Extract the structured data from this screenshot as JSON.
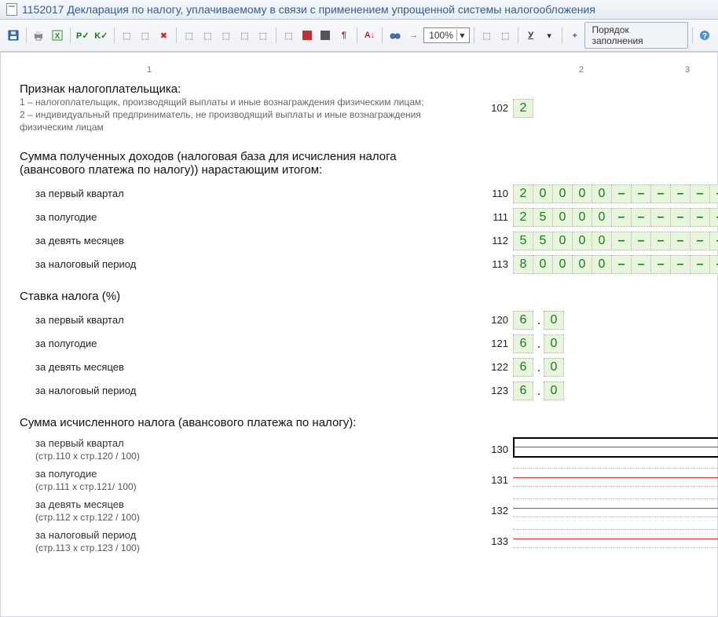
{
  "title": "1152017 Декларация по налогу, уплачиваемому в связи с применением упрощенной системы налогообложения",
  "toolbar": {
    "zoom": "100%",
    "order_button": "Порядок заполнения"
  },
  "columns": {
    "c1": "1",
    "c2": "2",
    "c3": "3"
  },
  "taxpayer_sign": {
    "title": "Признак налогоплательщика:",
    "note1": "1 – налогоплательщик, производящий выплаты и иные вознаграждения физическим лицам;",
    "note2": "2 – индивидуальный предприниматель, не производящий выплаты и иные вознаграждения физическим лицам",
    "code": "102",
    "value": "2"
  },
  "income": {
    "title": "Сумма полученных доходов (налоговая база для исчисления налога (авансового платежа по налогу)) нарастающим итогом:",
    "rows": [
      {
        "label": "за первый квартал",
        "code": "110",
        "digits": [
          "2",
          "0",
          "0",
          "0",
          "0",
          "–",
          "–",
          "–",
          "–",
          "–",
          "–"
        ]
      },
      {
        "label": "за полугодие",
        "code": "111",
        "digits": [
          "2",
          "5",
          "0",
          "0",
          "0",
          "–",
          "–",
          "–",
          "–",
          "–",
          "–"
        ]
      },
      {
        "label": "за девять месяцев",
        "code": "112",
        "digits": [
          "5",
          "5",
          "0",
          "0",
          "0",
          "–",
          "–",
          "–",
          "–",
          "–",
          "–"
        ]
      },
      {
        "label": "за налоговый период",
        "code": "113",
        "digits": [
          "8",
          "0",
          "0",
          "0",
          "0",
          "–",
          "–",
          "–",
          "–",
          "–",
          "–"
        ]
      }
    ]
  },
  "rate": {
    "title": "Ставка налога (%)",
    "rows": [
      {
        "label": "за первый квартал",
        "code": "120",
        "int": "6",
        "dec": "0"
      },
      {
        "label": "за полугодие",
        "code": "121",
        "int": "6",
        "dec": "0"
      },
      {
        "label": "за девять месяцев",
        "code": "122",
        "int": "6",
        "dec": "0"
      },
      {
        "label": "за налоговый период",
        "code": "123",
        "int": "6",
        "dec": "0"
      }
    ]
  },
  "calc": {
    "title": "Сумма исчисленного налога (авансового платежа по налогу):",
    "rows": [
      {
        "label": "за первый квартал",
        "formula": "(стр.110 x стр.120 / 100)",
        "code": "130",
        "focused": true
      },
      {
        "label": "за полугодие",
        "formula": "(стр.111 x стр.121/ 100)",
        "code": "131",
        "focused": false
      },
      {
        "label": "за девять месяцев",
        "formula": "(стр.112 x стр.122 / 100)",
        "code": "132",
        "focused": false
      },
      {
        "label": "за налоговый период",
        "formula": "(стр.113 x стр.123 / 100)",
        "code": "133",
        "focused": false
      }
    ]
  }
}
